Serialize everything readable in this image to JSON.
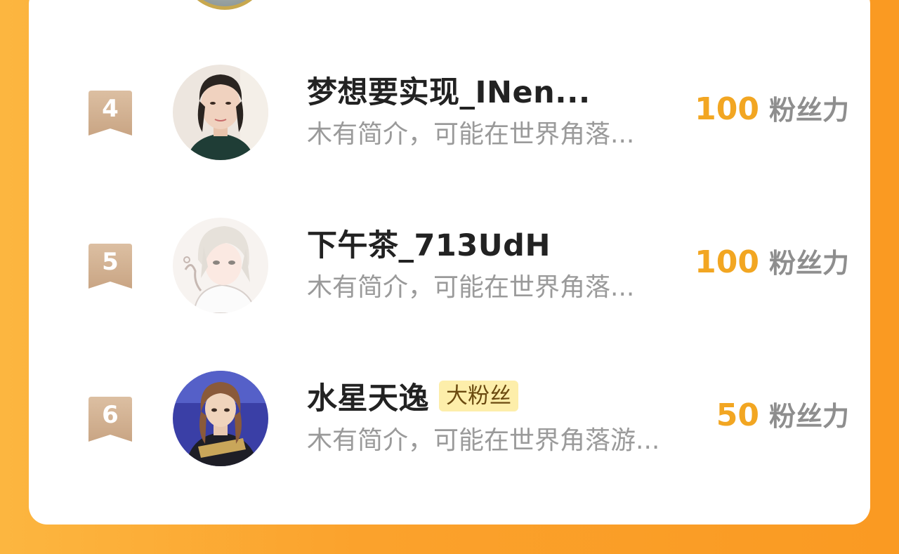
{
  "ranking": {
    "rows": [
      {
        "rank": "4",
        "name": "梦想要实现_INen...",
        "badge": "",
        "intro": "木有简介，可能在世界角落...",
        "score": "100",
        "unit": "粉丝力"
      },
      {
        "rank": "5",
        "name": "下午茶_713UdH",
        "badge": "",
        "intro": "木有简介，可能在世界角落...",
        "score": "100",
        "unit": "粉丝力"
      },
      {
        "rank": "6",
        "name": "水星天逸",
        "badge": "大粉丝",
        "intro": "木有简介，可能在世界角落游...",
        "score": "50",
        "unit": "粉丝力"
      }
    ]
  },
  "colors": {
    "background": "#fba22c",
    "score": "#f2a622",
    "ribbon": "#d9b79a",
    "badge_bg": "#fdeeaa"
  }
}
